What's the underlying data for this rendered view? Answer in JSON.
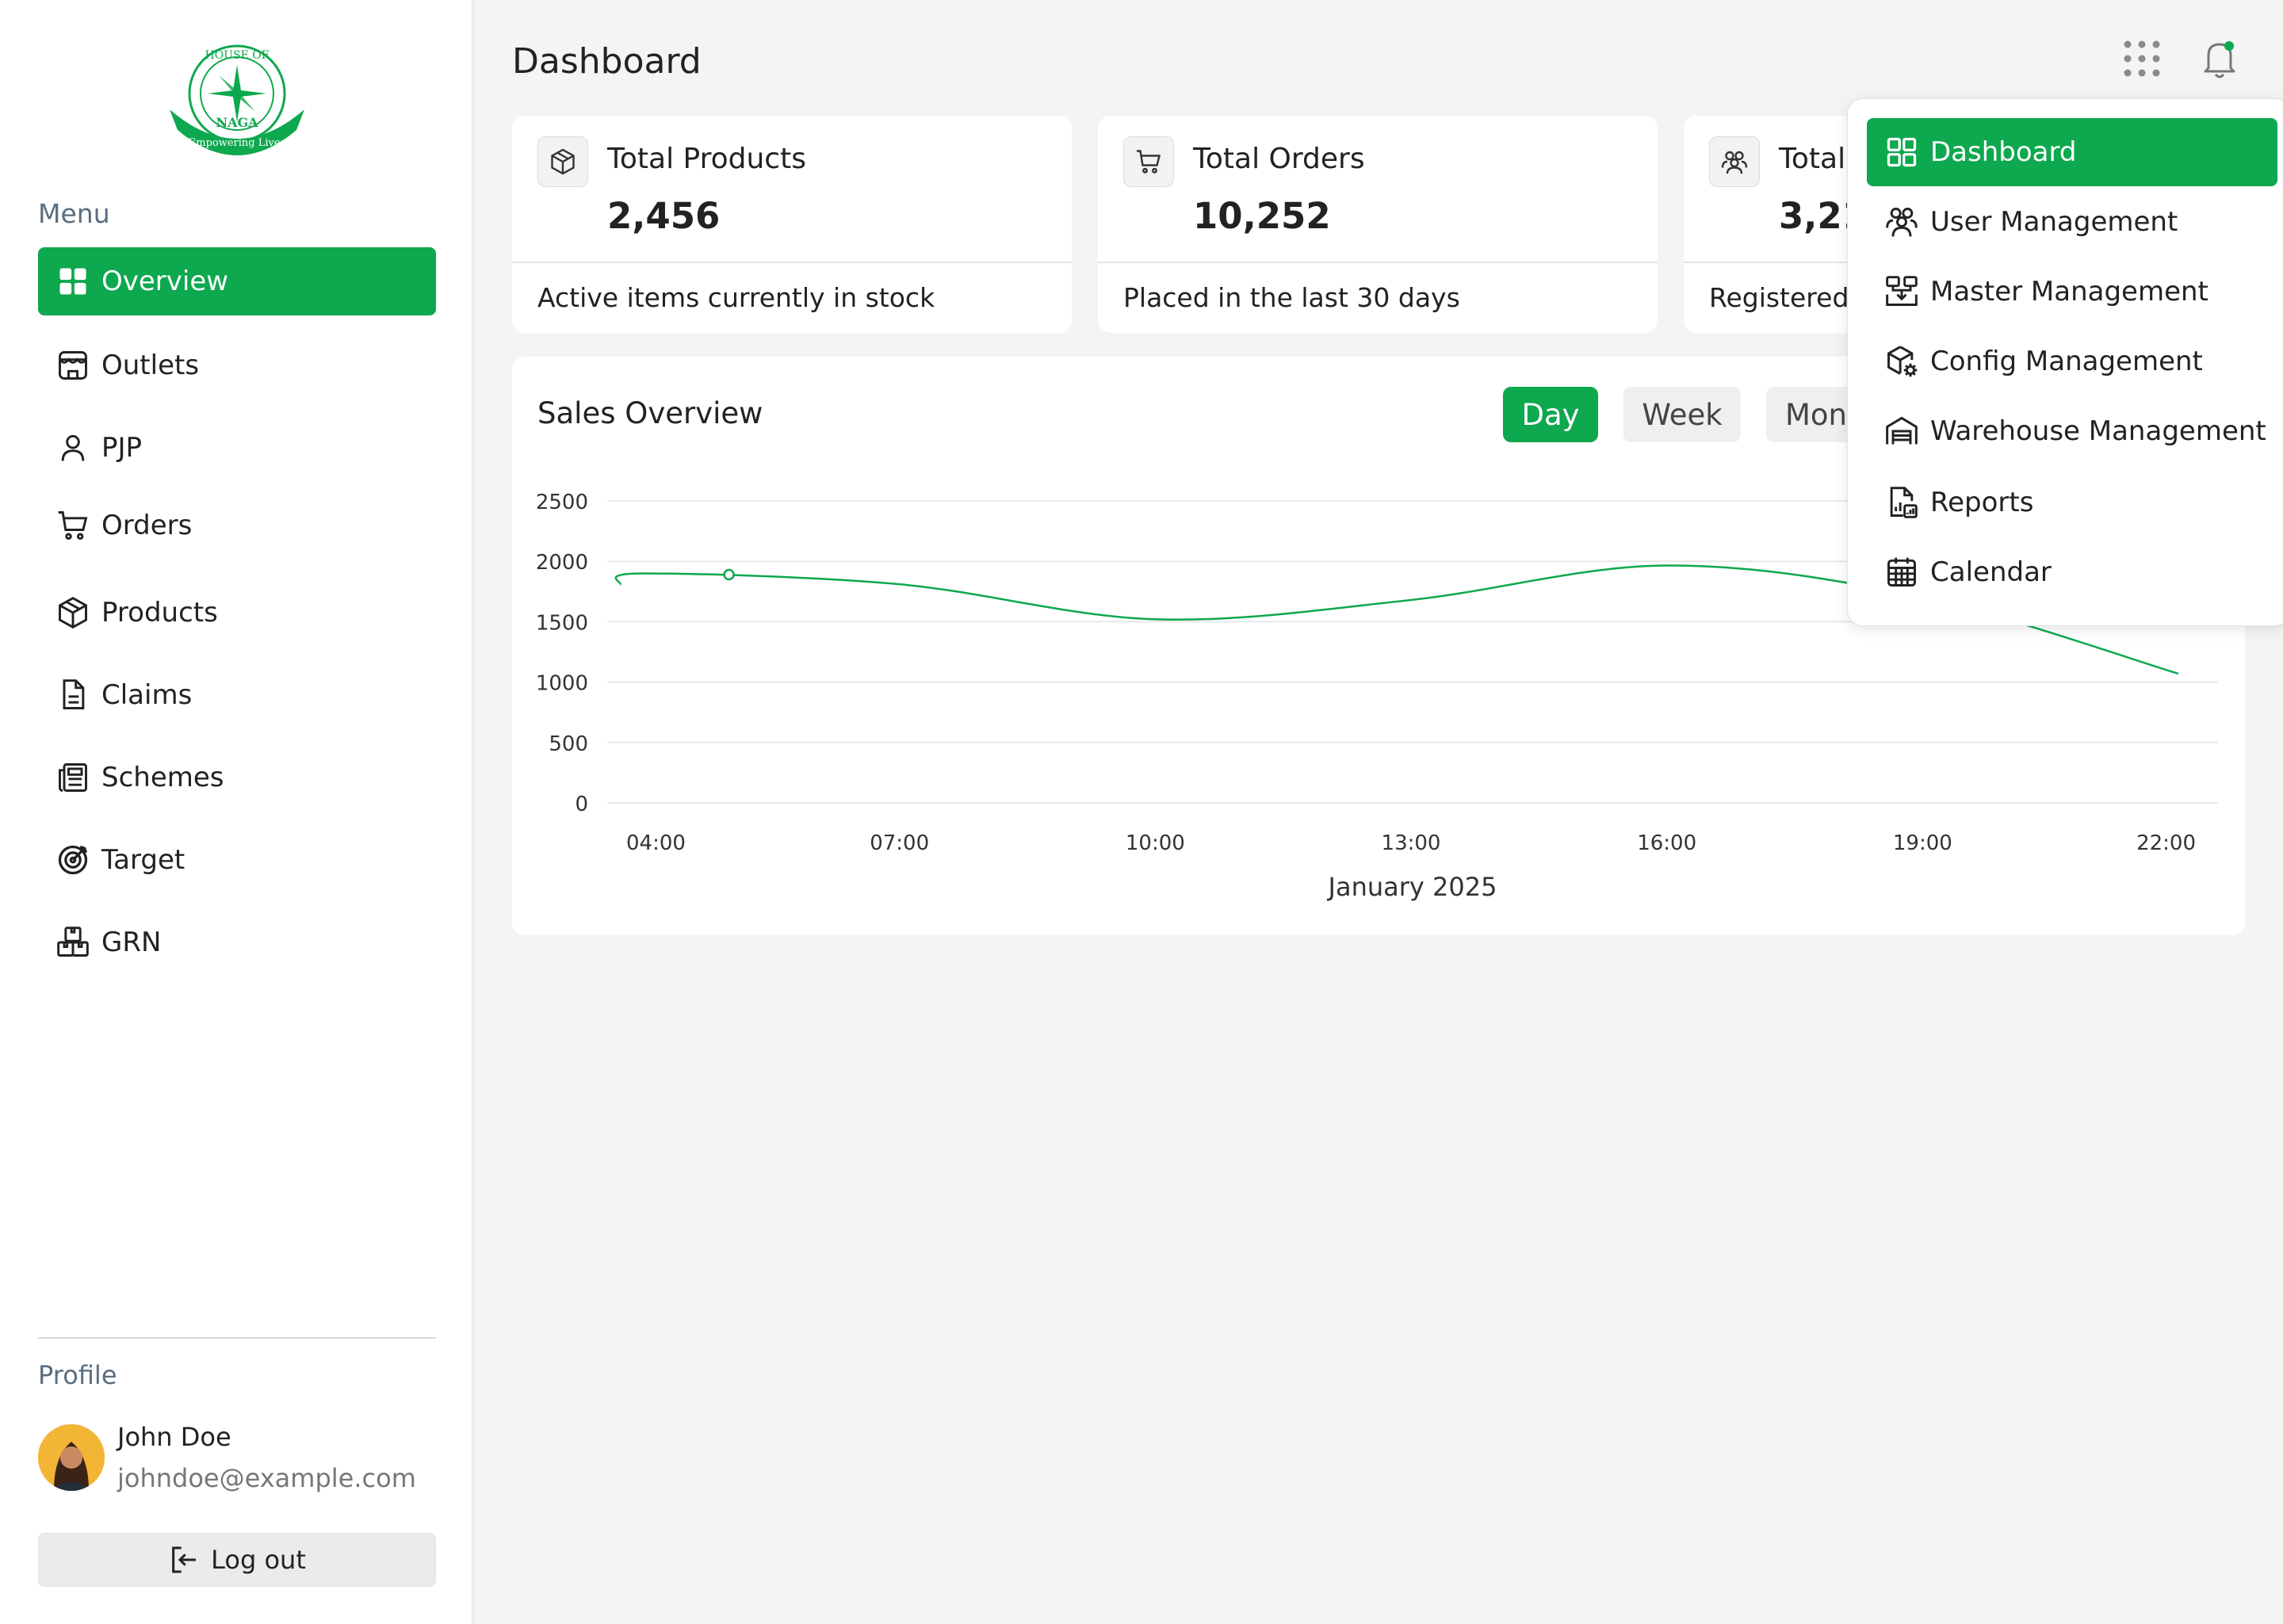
{
  "sidebar": {
    "menu_heading": "Menu",
    "items": [
      {
        "label": "Overview",
        "icon": "grid-icon"
      },
      {
        "label": "Outlets",
        "icon": "store-icon"
      },
      {
        "label": "PJP",
        "icon": "user-icon"
      },
      {
        "label": "Orders",
        "icon": "cart-icon"
      },
      {
        "label": "Products",
        "icon": "box-icon"
      },
      {
        "label": "Claims",
        "icon": "file-icon"
      },
      {
        "label": "Schemes",
        "icon": "newspaper-icon"
      },
      {
        "label": "Target",
        "icon": "target-icon"
      },
      {
        "label": "GRN",
        "icon": "boxes-icon"
      }
    ],
    "profile_heading": "Profile",
    "profile": {
      "name": "John Doe",
      "email": "johndoe@example.com"
    },
    "logout_label": "Log out"
  },
  "header": {
    "title": "Dashboard"
  },
  "cards": [
    {
      "title": "Total Products",
      "value": "2,456",
      "desc": "Active items currently in stock",
      "icon": "box-icon"
    },
    {
      "title": "Total Orders",
      "value": "10,252",
      "desc": "Placed in the last 30 days",
      "icon": "cart-icon"
    },
    {
      "title": "Total",
      "value": "3,21",
      "desc": "Registered",
      "icon": "users-icon"
    }
  ],
  "sales": {
    "title": "Sales Overview",
    "ranges": [
      "Day",
      "Week",
      "Mon"
    ],
    "active_range": "Day"
  },
  "chart_data": {
    "type": "line",
    "x": [
      "04:00",
      "07:00",
      "10:00",
      "13:00",
      "16:00",
      "19:00",
      "22:00"
    ],
    "series": [
      {
        "values": [
          1900,
          1810,
          1520,
          1680,
          1965,
          1700,
          1070
        ]
      }
    ],
    "yticks": [
      0,
      500,
      1000,
      1500,
      2000,
      2500
    ],
    "ylim": [
      0,
      2500
    ],
    "xlabel": "January 2025",
    "ylabel": "",
    "grid": true,
    "line_color": "#0ea84e",
    "highlight_point": {
      "x": "05:00",
      "y": 1890
    }
  },
  "dropdown": {
    "items": [
      {
        "label": "Dashboard",
        "icon": "grid-outline-icon"
      },
      {
        "label": "User Management",
        "icon": "users-icon"
      },
      {
        "label": "Master Management",
        "icon": "workflow-icon"
      },
      {
        "label": "Config Management",
        "icon": "box-settings-icon"
      },
      {
        "label": "Warehouse Management",
        "icon": "warehouse-icon"
      },
      {
        "label": "Reports",
        "icon": "file-chart-icon"
      },
      {
        "label": "Calendar",
        "icon": "calendar-icon"
      }
    ]
  },
  "colors": {
    "accent": "#0ea84e",
    "text": "#222222",
    "muted": "#5a6d7e"
  },
  "logo": {
    "top_text": "HOUSE OF",
    "name": "NAGA",
    "tagline": "Empowering Lives"
  }
}
